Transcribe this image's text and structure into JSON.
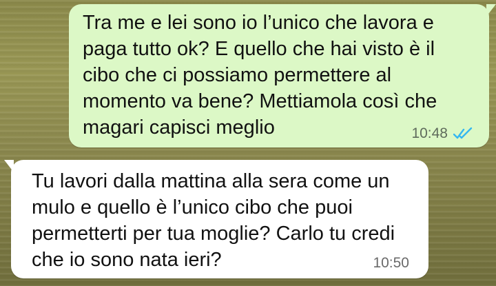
{
  "messages": [
    {
      "direction": "outgoing",
      "text": "Tra me e lei sono io l’unico che lavora e paga tutto ok? E quello che hai visto è il cibo che ci possiamo permettere al momento va bene? Mettiamola così che magari capisci meglio",
      "time": "10:48",
      "status": "read",
      "status_icon": "double-check-icon",
      "status_color": "#34b7f1"
    },
    {
      "direction": "incoming",
      "text": "Tu lavori dalla mattina alla sera come un mulo e quello è l’unico cibo che puoi permetterti per tua moglie? Carlo tu credi che io sono nata ieri?",
      "time": "10:50"
    }
  ],
  "colors": {
    "outgoing_bubble": "#dcf8c6",
    "incoming_bubble": "#ffffff",
    "wallpaper": "#8c8a4b"
  }
}
